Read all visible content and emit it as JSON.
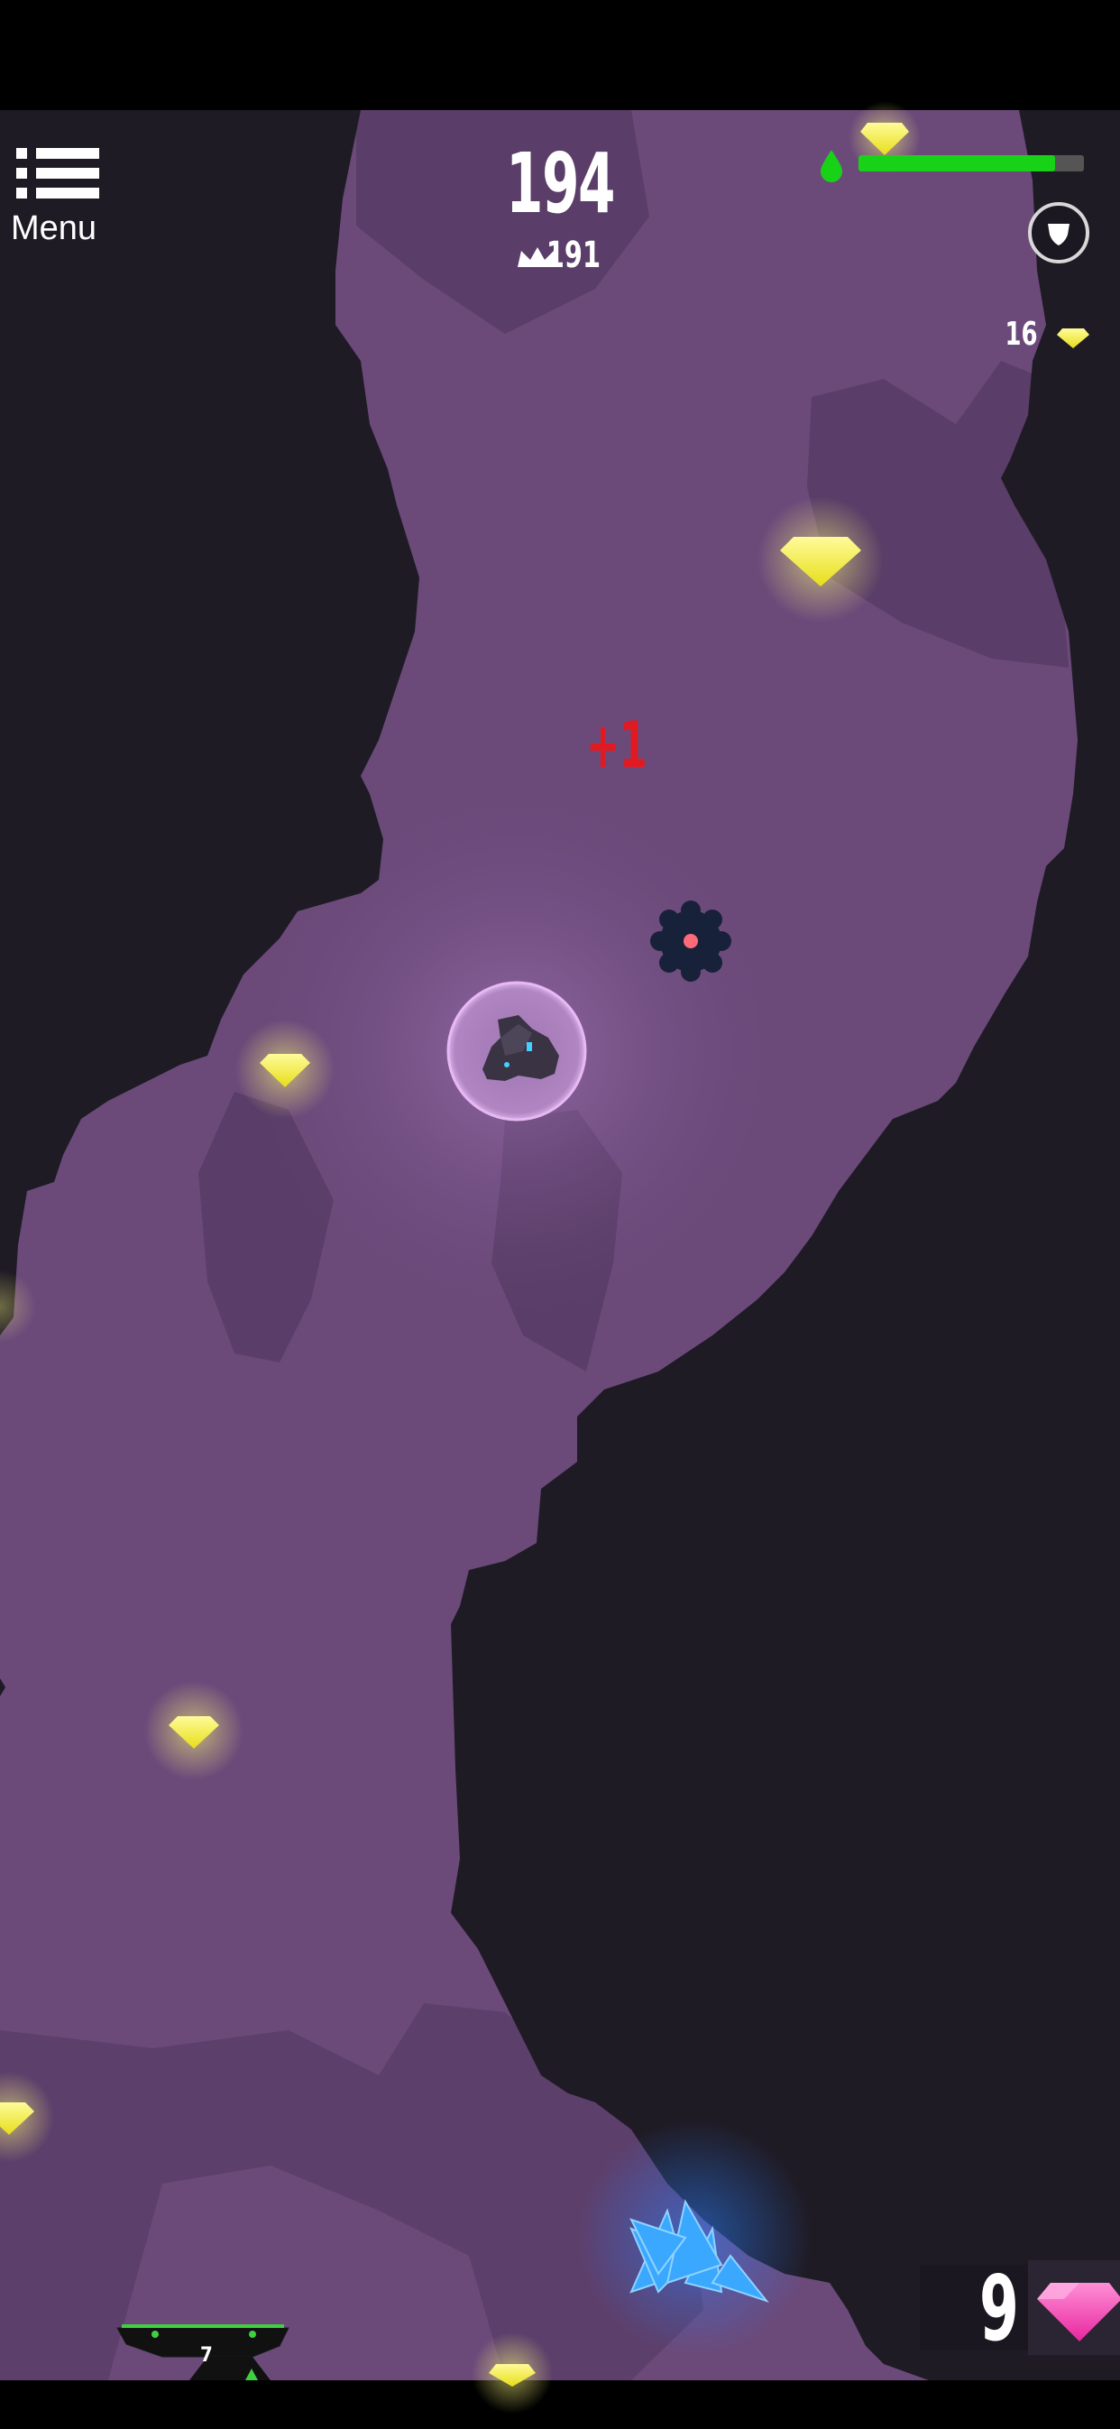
{
  "hud": {
    "menu_label": "Menu",
    "score": "194",
    "best_score": "191",
    "gem_count": "16",
    "fuel_fraction": 0.87,
    "popup": "+1",
    "pink_gems": "9",
    "ship_level": "7"
  },
  "colors": {
    "cave_fill": "#6b4a7a",
    "rock": "#1f1b25",
    "rock_light": "#5a3d68",
    "fuel": "#18d218",
    "gem_yellow": "#f4f03a",
    "gem_pink": "#ff4fb8",
    "crystal_blue": "#3aa8ff",
    "score_popup": "#e01a22"
  },
  "icons": {
    "menu": "hamburger-icon",
    "best": "crown-icon",
    "fuel": "fuel-drop-icon",
    "shield": "shield-icon",
    "gem": "yellow-gem-icon",
    "pink_gem": "pink-gem-icon"
  }
}
